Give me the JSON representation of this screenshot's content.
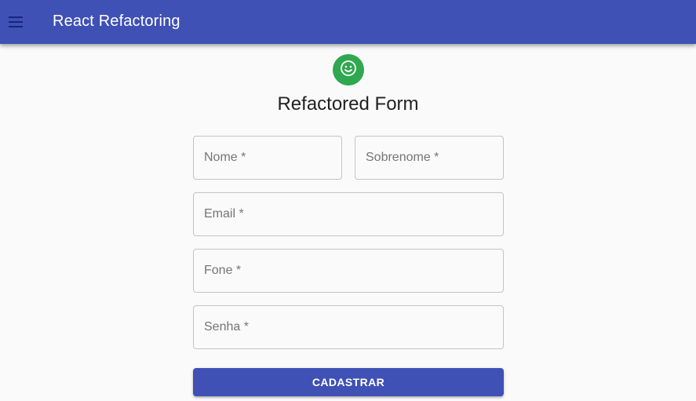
{
  "appbar": {
    "title": "React Refactoring",
    "menu_icon": "hamburger-menu-icon",
    "color": "#3f51b5"
  },
  "header": {
    "avatar_icon": "smiley-face-icon",
    "avatar_color": "#2fa84f",
    "title": "Refactored Form"
  },
  "form": {
    "fields": [
      {
        "label": "Nome *",
        "value": ""
      },
      {
        "label": "Sobrenome *",
        "value": ""
      },
      {
        "label": "Email *",
        "value": ""
      },
      {
        "label": "Fone *",
        "value": ""
      },
      {
        "label": "Senha *",
        "value": ""
      }
    ],
    "submit_label": "CADASTRAR"
  }
}
